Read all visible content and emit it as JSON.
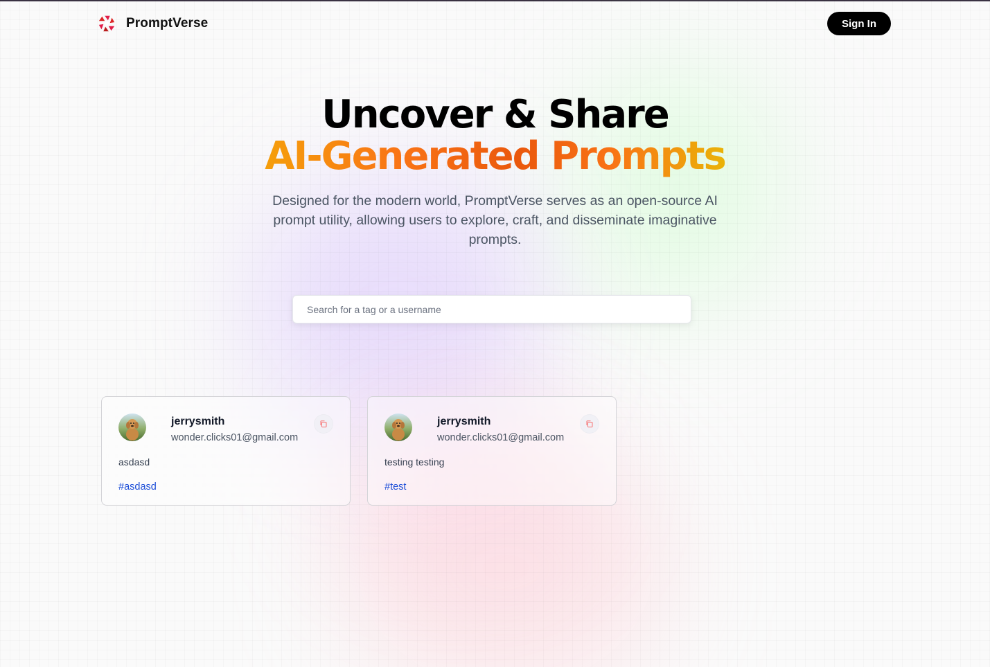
{
  "nav": {
    "brand_name": "PromptVerse",
    "sign_in_label": "Sign In"
  },
  "hero": {
    "title_line1": "Uncover & Share",
    "title_line2": "AI-Generated Prompts",
    "description": "Designed for the modern world, PromptVerse serves as an open-source AI prompt utility, allowing users to explore, craft, and disseminate imaginative prompts."
  },
  "search": {
    "placeholder": "Search for a tag or a username",
    "value": ""
  },
  "prompts": [
    {
      "username": "jerrysmith",
      "email": "wonder.clicks01@gmail.com",
      "prompt": "asdasd",
      "tag": "#asdasd"
    },
    {
      "username": "jerrysmith",
      "email": "wonder.clicks01@gmail.com",
      "prompt": "testing testing",
      "tag": "#test"
    }
  ],
  "icons": {
    "logo": "promptverse-logo-icon",
    "copy": "copy-icon",
    "avatar": "user-avatar-dog"
  },
  "colors": {
    "accent_gradient_start": "#f59e0b",
    "accent_gradient_mid": "#ea580c",
    "accent_gradient_end": "#eab308",
    "tag_color": "#1d4ed8",
    "button_bg": "#000000"
  }
}
